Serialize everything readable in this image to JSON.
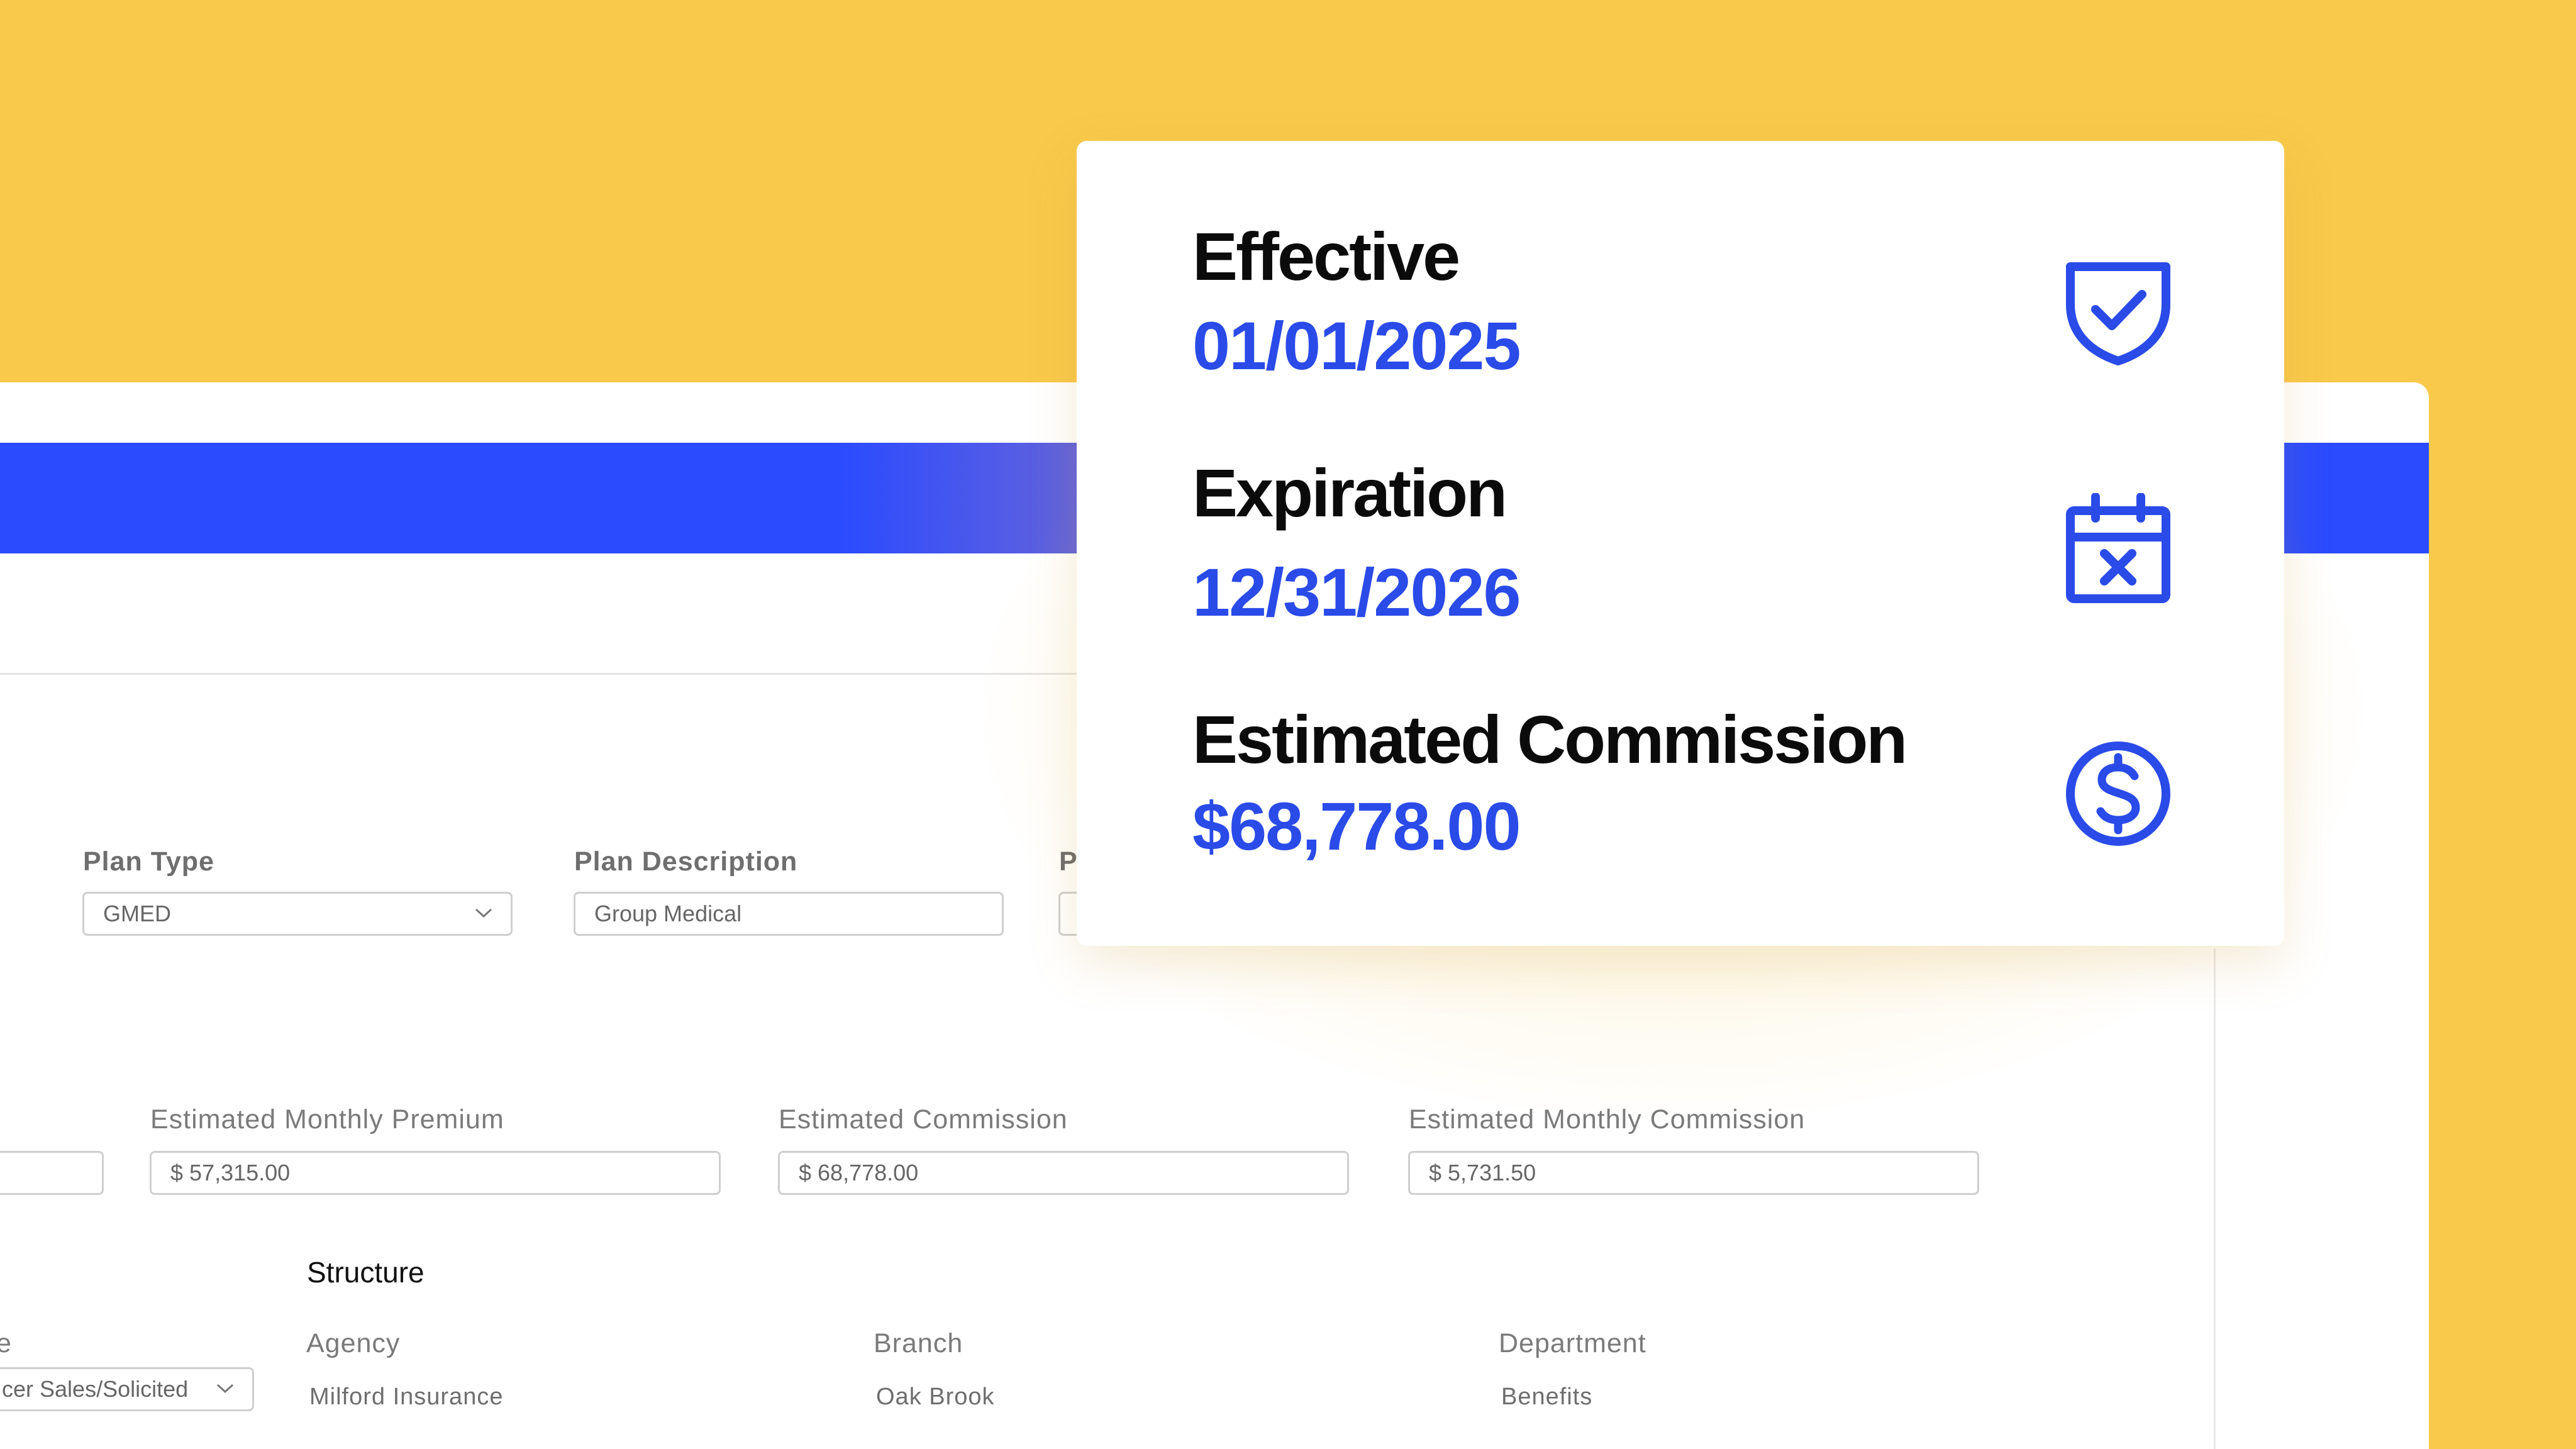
{
  "form": {
    "plan_type": {
      "label": "Plan Type",
      "value": "GMED"
    },
    "plan_description": {
      "label": "Plan Description",
      "value": "Group Medical"
    },
    "partial_label": "P",
    "estimated_monthly_premium": {
      "label": "Estimated Monthly Premium",
      "value": "$ 57,315.00"
    },
    "estimated_commission": {
      "label": "Estimated Commission",
      "value": "$ 68,778.00"
    },
    "estimated_monthly_commission": {
      "label": "Estimated Monthly Commission",
      "value": "$ 5,731.50"
    },
    "structure": {
      "title": "Structure",
      "partial_label": "e",
      "producer_type_value": "cer Sales/Solicited",
      "agency": {
        "label": "Agency",
        "value": "Milford Insurance"
      },
      "branch": {
        "label": "Branch",
        "value": "Oak Brook"
      },
      "department": {
        "label": "Department",
        "value": "Benefits"
      }
    }
  },
  "summary_card": {
    "effective": {
      "label": "Effective",
      "value": "01/01/2025",
      "icon": "shield-check-icon"
    },
    "expiration": {
      "label": "Expiration",
      "value": "12/31/2026",
      "icon": "calendar-x-icon"
    },
    "estimated_commission": {
      "label": "Estimated Commission",
      "value": "$68,778.00",
      "icon": "dollar-circle-icon"
    }
  },
  "colors": {
    "background": "#F8C94B",
    "accent_blue": "#2A4BFF",
    "value_blue": "#2A4BE8"
  }
}
